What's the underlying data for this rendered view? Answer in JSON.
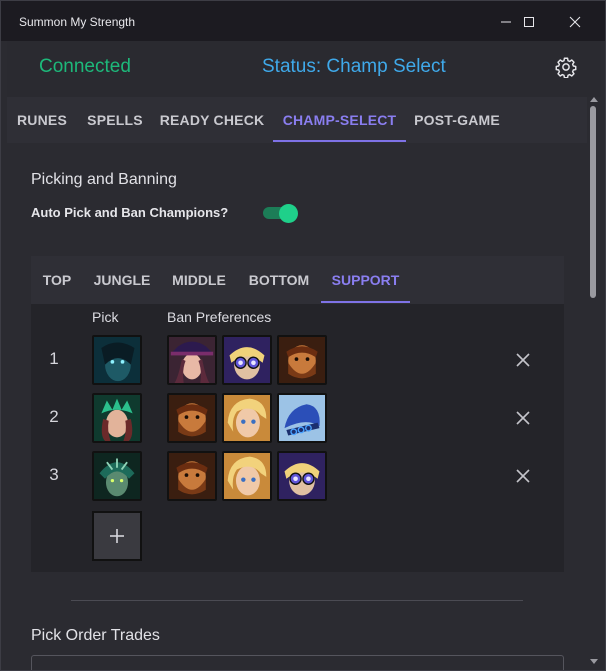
{
  "window": {
    "title": "Summon My Strength"
  },
  "header": {
    "connection": "Connected",
    "status": "Status: Champ Select"
  },
  "tabs": [
    "RUNES",
    "SPELLS",
    "READY CHECK",
    "CHAMP-SELECT",
    "POST-GAME"
  ],
  "active_tab": "CHAMP-SELECT",
  "picking": {
    "section_title": "Picking and Banning",
    "toggle_label": "Auto Pick and Ban Champions?",
    "toggle_on": true
  },
  "roles": [
    "TOP",
    "JUNGLE",
    "MIDDLE",
    "BOTTOM",
    "SUPPORT"
  ],
  "active_role": "SUPPORT",
  "columns": {
    "pick": "Pick",
    "bans": "Ban Preferences"
  },
  "rows": [
    {
      "num": "1",
      "pick": "champion-portrait-dark-teal",
      "bans": [
        "champion-portrait-hat",
        "champion-portrait-goggles",
        "champion-portrait-brown-beard"
      ]
    },
    {
      "num": "2",
      "pick": "champion-portrait-green-crown",
      "bans": [
        "champion-portrait-brown-beard",
        "champion-portrait-blonde",
        "champion-portrait-blue-chains"
      ]
    },
    {
      "num": "3",
      "pick": "champion-portrait-serpent",
      "bans": [
        "champion-portrait-brown-beard",
        "champion-portrait-blonde",
        "champion-portrait-goggles"
      ]
    }
  ],
  "trades": {
    "section_title": "Pick Order Trades"
  },
  "colors": {
    "connected": "#1db87a",
    "status": "#3fa9ea",
    "accent": "#8a7ef0",
    "toggle": "#1fd08a"
  }
}
